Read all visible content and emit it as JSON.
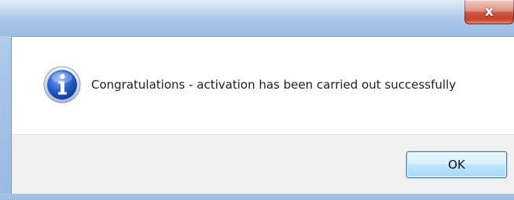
{
  "window": {
    "close_glyph": "x"
  },
  "dialog": {
    "icon": "information-icon",
    "message": "Congratulations - activation has been carried out successfully",
    "ok_label": "OK"
  },
  "colors": {
    "frame": "#a9c7e8",
    "close_button": "#c94a33",
    "button_bar": "#f0f0f0",
    "info_icon_blue": "#1f4fb5"
  }
}
